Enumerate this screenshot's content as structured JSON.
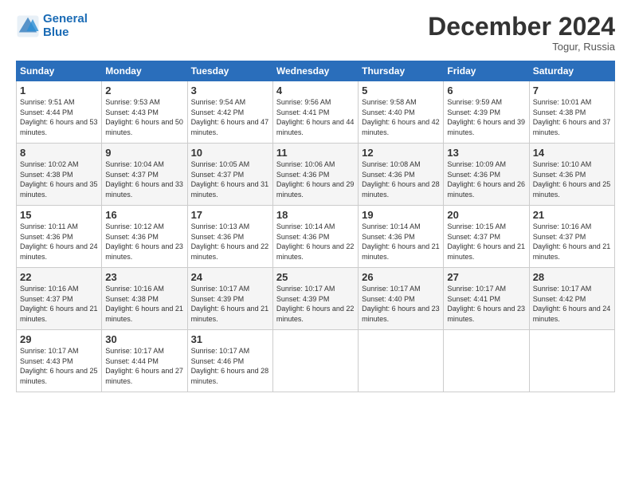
{
  "logo": {
    "line1": "General",
    "line2": "Blue"
  },
  "title": "December 2024",
  "location": "Togur, Russia",
  "days_header": [
    "Sunday",
    "Monday",
    "Tuesday",
    "Wednesday",
    "Thursday",
    "Friday",
    "Saturday"
  ],
  "weeks": [
    [
      {
        "day": "1",
        "rise": "Sunrise: 9:51 AM",
        "set": "Sunset: 4:44 PM",
        "daylight": "Daylight: 6 hours and 53 minutes."
      },
      {
        "day": "2",
        "rise": "Sunrise: 9:53 AM",
        "set": "Sunset: 4:43 PM",
        "daylight": "Daylight: 6 hours and 50 minutes."
      },
      {
        "day": "3",
        "rise": "Sunrise: 9:54 AM",
        "set": "Sunset: 4:42 PM",
        "daylight": "Daylight: 6 hours and 47 minutes."
      },
      {
        "day": "4",
        "rise": "Sunrise: 9:56 AM",
        "set": "Sunset: 4:41 PM",
        "daylight": "Daylight: 6 hours and 44 minutes."
      },
      {
        "day": "5",
        "rise": "Sunrise: 9:58 AM",
        "set": "Sunset: 4:40 PM",
        "daylight": "Daylight: 6 hours and 42 minutes."
      },
      {
        "day": "6",
        "rise": "Sunrise: 9:59 AM",
        "set": "Sunset: 4:39 PM",
        "daylight": "Daylight: 6 hours and 39 minutes."
      },
      {
        "day": "7",
        "rise": "Sunrise: 10:01 AM",
        "set": "Sunset: 4:38 PM",
        "daylight": "Daylight: 6 hours and 37 minutes."
      }
    ],
    [
      {
        "day": "8",
        "rise": "Sunrise: 10:02 AM",
        "set": "Sunset: 4:38 PM",
        "daylight": "Daylight: 6 hours and 35 minutes."
      },
      {
        "day": "9",
        "rise": "Sunrise: 10:04 AM",
        "set": "Sunset: 4:37 PM",
        "daylight": "Daylight: 6 hours and 33 minutes."
      },
      {
        "day": "10",
        "rise": "Sunrise: 10:05 AM",
        "set": "Sunset: 4:37 PM",
        "daylight": "Daylight: 6 hours and 31 minutes."
      },
      {
        "day": "11",
        "rise": "Sunrise: 10:06 AM",
        "set": "Sunset: 4:36 PM",
        "daylight": "Daylight: 6 hours and 29 minutes."
      },
      {
        "day": "12",
        "rise": "Sunrise: 10:08 AM",
        "set": "Sunset: 4:36 PM",
        "daylight": "Daylight: 6 hours and 28 minutes."
      },
      {
        "day": "13",
        "rise": "Sunrise: 10:09 AM",
        "set": "Sunset: 4:36 PM",
        "daylight": "Daylight: 6 hours and 26 minutes."
      },
      {
        "day": "14",
        "rise": "Sunrise: 10:10 AM",
        "set": "Sunset: 4:36 PM",
        "daylight": "Daylight: 6 hours and 25 minutes."
      }
    ],
    [
      {
        "day": "15",
        "rise": "Sunrise: 10:11 AM",
        "set": "Sunset: 4:36 PM",
        "daylight": "Daylight: 6 hours and 24 minutes."
      },
      {
        "day": "16",
        "rise": "Sunrise: 10:12 AM",
        "set": "Sunset: 4:36 PM",
        "daylight": "Daylight: 6 hours and 23 minutes."
      },
      {
        "day": "17",
        "rise": "Sunrise: 10:13 AM",
        "set": "Sunset: 4:36 PM",
        "daylight": "Daylight: 6 hours and 22 minutes."
      },
      {
        "day": "18",
        "rise": "Sunrise: 10:14 AM",
        "set": "Sunset: 4:36 PM",
        "daylight": "Daylight: 6 hours and 22 minutes."
      },
      {
        "day": "19",
        "rise": "Sunrise: 10:14 AM",
        "set": "Sunset: 4:36 PM",
        "daylight": "Daylight: 6 hours and 21 minutes."
      },
      {
        "day": "20",
        "rise": "Sunrise: 10:15 AM",
        "set": "Sunset: 4:37 PM",
        "daylight": "Daylight: 6 hours and 21 minutes."
      },
      {
        "day": "21",
        "rise": "Sunrise: 10:16 AM",
        "set": "Sunset: 4:37 PM",
        "daylight": "Daylight: 6 hours and 21 minutes."
      }
    ],
    [
      {
        "day": "22",
        "rise": "Sunrise: 10:16 AM",
        "set": "Sunset: 4:37 PM",
        "daylight": "Daylight: 6 hours and 21 minutes."
      },
      {
        "day": "23",
        "rise": "Sunrise: 10:16 AM",
        "set": "Sunset: 4:38 PM",
        "daylight": "Daylight: 6 hours and 21 minutes."
      },
      {
        "day": "24",
        "rise": "Sunrise: 10:17 AM",
        "set": "Sunset: 4:39 PM",
        "daylight": "Daylight: 6 hours and 21 minutes."
      },
      {
        "day": "25",
        "rise": "Sunrise: 10:17 AM",
        "set": "Sunset: 4:39 PM",
        "daylight": "Daylight: 6 hours and 22 minutes."
      },
      {
        "day": "26",
        "rise": "Sunrise: 10:17 AM",
        "set": "Sunset: 4:40 PM",
        "daylight": "Daylight: 6 hours and 23 minutes."
      },
      {
        "day": "27",
        "rise": "Sunrise: 10:17 AM",
        "set": "Sunset: 4:41 PM",
        "daylight": "Daylight: 6 hours and 23 minutes."
      },
      {
        "day": "28",
        "rise": "Sunrise: 10:17 AM",
        "set": "Sunset: 4:42 PM",
        "daylight": "Daylight: 6 hours and 24 minutes."
      }
    ],
    [
      {
        "day": "29",
        "rise": "Sunrise: 10:17 AM",
        "set": "Sunset: 4:43 PM",
        "daylight": "Daylight: 6 hours and 25 minutes."
      },
      {
        "day": "30",
        "rise": "Sunrise: 10:17 AM",
        "set": "Sunset: 4:44 PM",
        "daylight": "Daylight: 6 hours and 27 minutes."
      },
      {
        "day": "31",
        "rise": "Sunrise: 10:17 AM",
        "set": "Sunset: 4:46 PM",
        "daylight": "Daylight: 6 hours and 28 minutes."
      },
      null,
      null,
      null,
      null
    ]
  ]
}
